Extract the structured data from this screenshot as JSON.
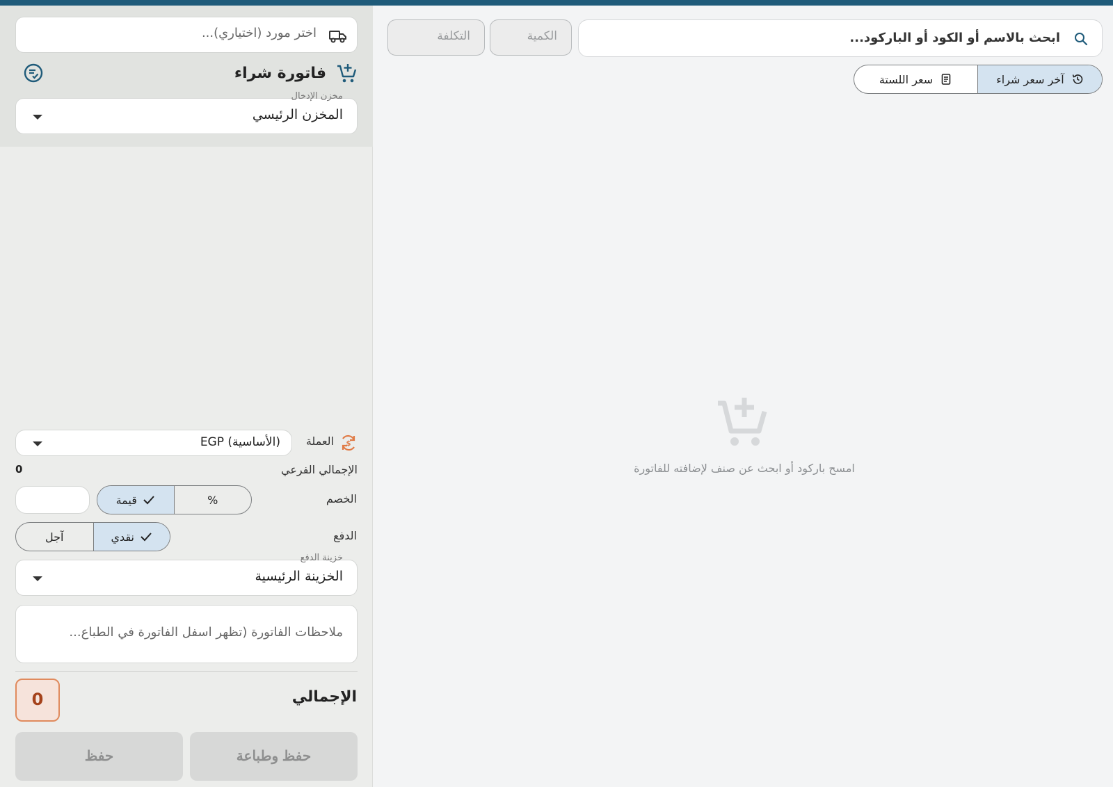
{
  "search": {
    "placeholder": "ابحث بالاسم أو الكود أو الباركود..."
  },
  "qty_field": {
    "placeholder": "الكمية"
  },
  "cost_field": {
    "placeholder": "التكلفة"
  },
  "price_mode": {
    "options": [
      {
        "label": "آخر سعر شراء",
        "icon": "history-icon",
        "selected": true
      },
      {
        "label": "سعر اللستة",
        "icon": "price-list-icon",
        "selected": false
      }
    ]
  },
  "empty_state": {
    "message": "امسح باركود أو ابحث عن صنف لإضافته للفاتورة",
    "icon": "add-to-cart-icon"
  },
  "invoice": {
    "supplier_placeholder": "اختر مورد (اختياري)...",
    "title": "فاتورة شراء",
    "warehouse": {
      "label": "مخزن الإدخال",
      "value": "المخزن الرئيسي"
    },
    "currency": {
      "label": "العملة",
      "value": "EGP (الأساسية)"
    },
    "subtotal": {
      "label": "الإجمالي الفرعي",
      "value": "0"
    },
    "discount": {
      "label": "الخصم",
      "options": [
        "قيمة",
        "%"
      ],
      "selected": "قيمة",
      "value": ""
    },
    "payment": {
      "label": "الدفع",
      "options": [
        "نقدي",
        "آجل"
      ],
      "selected": "نقدي"
    },
    "treasury": {
      "label": "خزينة الدفع",
      "value": "الخزينة الرئيسية"
    },
    "notes_placeholder": "ملاحظات الفاتورة (تظهر اسفل الفاتورة في الطباعة)",
    "notes_display": "ملاحظات الفاتورة (تظهر اسفل الفاتورة في الطباع...",
    "total": {
      "label": "الإجمالي",
      "value": "0"
    },
    "save_print_label": "حفظ وطباعة",
    "save_label": "حفظ"
  },
  "colors": {
    "accent": "#1f5b7a",
    "selected": "#d4e3f0",
    "total_accent": "#e08a5d"
  }
}
